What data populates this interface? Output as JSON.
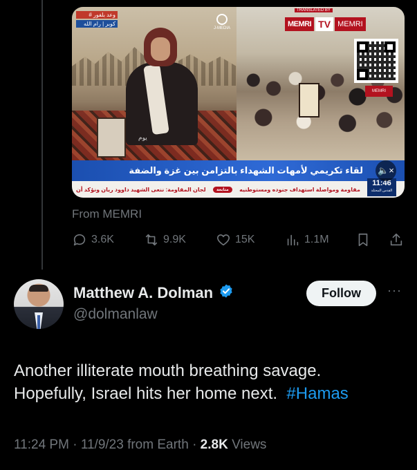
{
  "quoted_post": {
    "video": {
      "channel_tag_top": "# وعد بلفور",
      "channel_tag_bottom": "كوبر | رام الله",
      "station_logo": "J-MEDIA",
      "watermark_text": "يوم",
      "memri_brand_left": "MEMRI",
      "memri_brand_tv": "TV",
      "memri_brand_right": "MEMRI",
      "memri_sub": "TRANSLATED BY",
      "memri_tag": "MEMRI",
      "headline": "لقاء تكريمي لأمهات الشهداء بالتزامن بين غزة والضفة",
      "ticker_text_1": "مقاومة ومواصلة استهداف جنوده ومستوطنيه",
      "ticker_pill": "متابعة",
      "ticker_text_2": "لجان المقاومة: ننعى الشهيد داوود ريان ونؤكد أن",
      "clock_time": "11:46",
      "clock_label": "القدس المحتلة",
      "mute_icon": "🔈×"
    },
    "source_label": "From MEMRI",
    "actions": {
      "replies": "3.6K",
      "reposts": "9.9K",
      "likes": "15K",
      "views": "1.1M"
    }
  },
  "reply": {
    "author_name": "Matthew A. Dolman",
    "handle": "@dolmanlaw",
    "follow_label": "Follow",
    "more_label": "···",
    "text_line1": "Another illiterate mouth breathing savage.",
    "text_line2_prefix": "Hopefully, Israel hits her home next.",
    "hashtag": "#Hamas",
    "time": "11:24 PM",
    "date": "11/9/23",
    "from": "from Earth",
    "separator": "·",
    "views_count": "2.8K",
    "views_label": "Views"
  },
  "colors": {
    "background": "#000000",
    "text_primary": "#e7e9ea",
    "text_secondary": "#71767b",
    "accent_blue": "#1d9bf0"
  }
}
